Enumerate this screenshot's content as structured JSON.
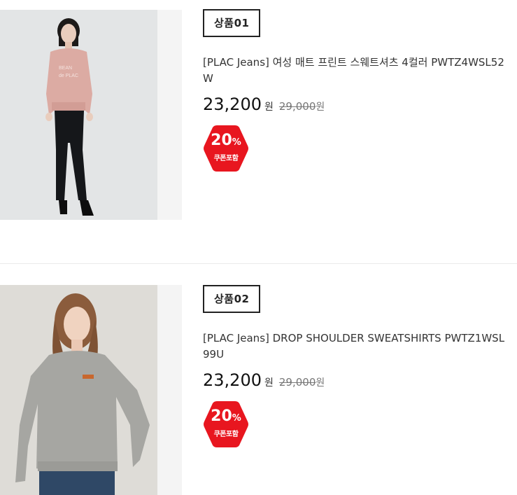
{
  "products": [
    {
      "badge": "상품01",
      "title": "[PLAC Jeans] 여성 매트 프린트 스웨트셔츠 4컬러 PWTZ4WSL52W",
      "price": "23,200",
      "currency": "원",
      "original_price": "29,000",
      "original_currency": "원",
      "discount_percent": "20",
      "percent_sign": "%",
      "discount_label": "쿠폰포함",
      "image": "photo-model-pink-sweatshirt-black-jeans"
    },
    {
      "badge": "상품02",
      "title": "[PLAC Jeans] DROP SHOULDER SWEATSHIRTS PWTZ1WSL99U",
      "price": "23,200",
      "currency": "원",
      "original_price": "29,000",
      "original_currency": "원",
      "discount_percent": "20",
      "percent_sign": "%",
      "discount_label": "쿠폰포함",
      "image": "photo-model-gray-sweatshirt"
    }
  ],
  "colors": {
    "discount_badge": "#e8161f",
    "text": "#222222",
    "strikethrough": "#777777"
  }
}
